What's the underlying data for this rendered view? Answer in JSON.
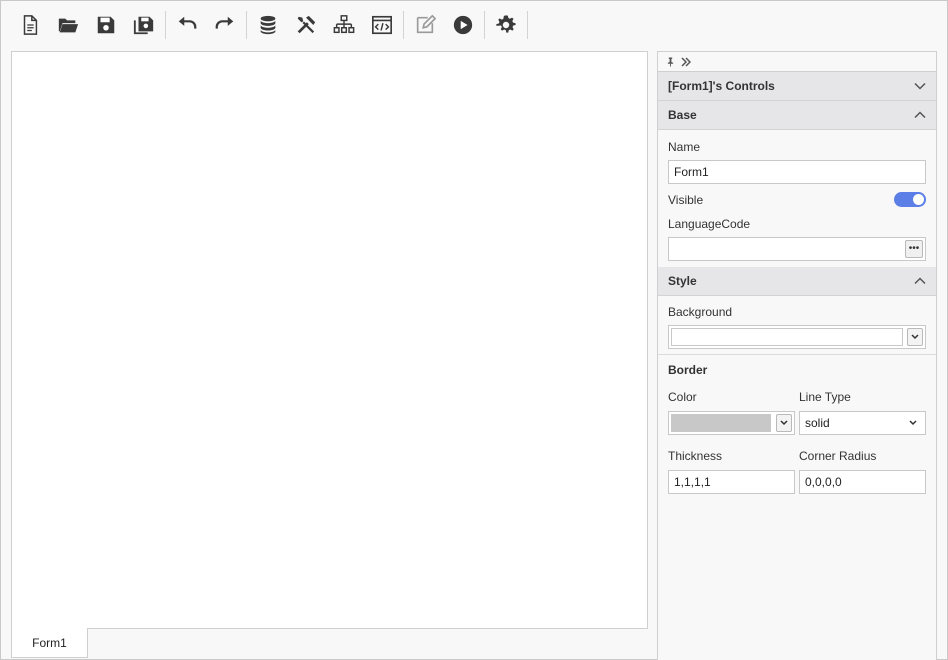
{
  "toolbar": {
    "buttons": [
      {
        "name": "new-file-icon"
      },
      {
        "name": "open-folder-icon"
      },
      {
        "name": "save-icon"
      },
      {
        "name": "save-all-icon"
      },
      {
        "name": "undo-icon"
      },
      {
        "name": "redo-icon"
      },
      {
        "name": "database-icon"
      },
      {
        "name": "tools-icon"
      },
      {
        "name": "hierarchy-icon"
      },
      {
        "name": "code-window-icon"
      },
      {
        "name": "edit-icon"
      },
      {
        "name": "play-icon"
      },
      {
        "name": "settings-gear-icon"
      }
    ]
  },
  "designer": {
    "tab_label": "Form1"
  },
  "properties": {
    "controls_header": "[Form1]'s Controls",
    "base": {
      "title": "Base",
      "name_label": "Name",
      "name_value": "Form1",
      "visible_label": "Visible",
      "visible_on": true,
      "language_label": "LanguageCode",
      "language_value": ""
    },
    "style": {
      "title": "Style",
      "background_label": "Background",
      "background_value": ""
    },
    "border": {
      "title": "Border",
      "color_label": "Color",
      "color_value": "#c8c8c8",
      "linetype_label": "Line Type",
      "linetype_value": "solid",
      "thickness_label": "Thickness",
      "thickness_value": "1,1,1,1",
      "corner_label": "Corner Radius",
      "corner_value": "0,0,0,0"
    }
  },
  "colors": {
    "toolbar_icon": "#3a3a3a",
    "toggle_accent": "#5b7fe6",
    "section_header_bg": "#e6e6e8"
  }
}
